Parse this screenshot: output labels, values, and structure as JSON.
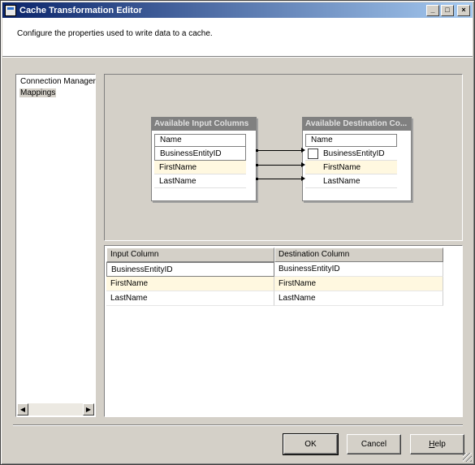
{
  "window": {
    "title": "Cache Transformation Editor"
  },
  "header": {
    "description": "Configure the properties used to write data to a cache."
  },
  "nav": {
    "items": [
      "Connection Manager",
      "Mappings"
    ]
  },
  "diagram": {
    "input_table": {
      "title": "Available Input Columns",
      "header": "Name",
      "rows": [
        "BusinessEntityID",
        "FirstName",
        "LastName"
      ]
    },
    "dest_table": {
      "title": "Available Destination Co...",
      "header": "Name",
      "rows": [
        "BusinessEntityID",
        "FirstName",
        "LastName"
      ]
    }
  },
  "grid": {
    "headers": [
      "Input Column",
      "Destination Column"
    ],
    "rows": [
      [
        "BusinessEntityID",
        "BusinessEntityID"
      ],
      [
        "FirstName",
        "FirstName"
      ],
      [
        "LastName",
        "LastName"
      ]
    ]
  },
  "buttons": {
    "ok": "OK",
    "cancel": "Cancel",
    "help_prefix": "",
    "help_underline": "H",
    "help_rest": "elp"
  },
  "colors": {
    "title_start": "#0a246a",
    "title_end": "#a6caf0",
    "selected_row": "#fff8e0"
  }
}
